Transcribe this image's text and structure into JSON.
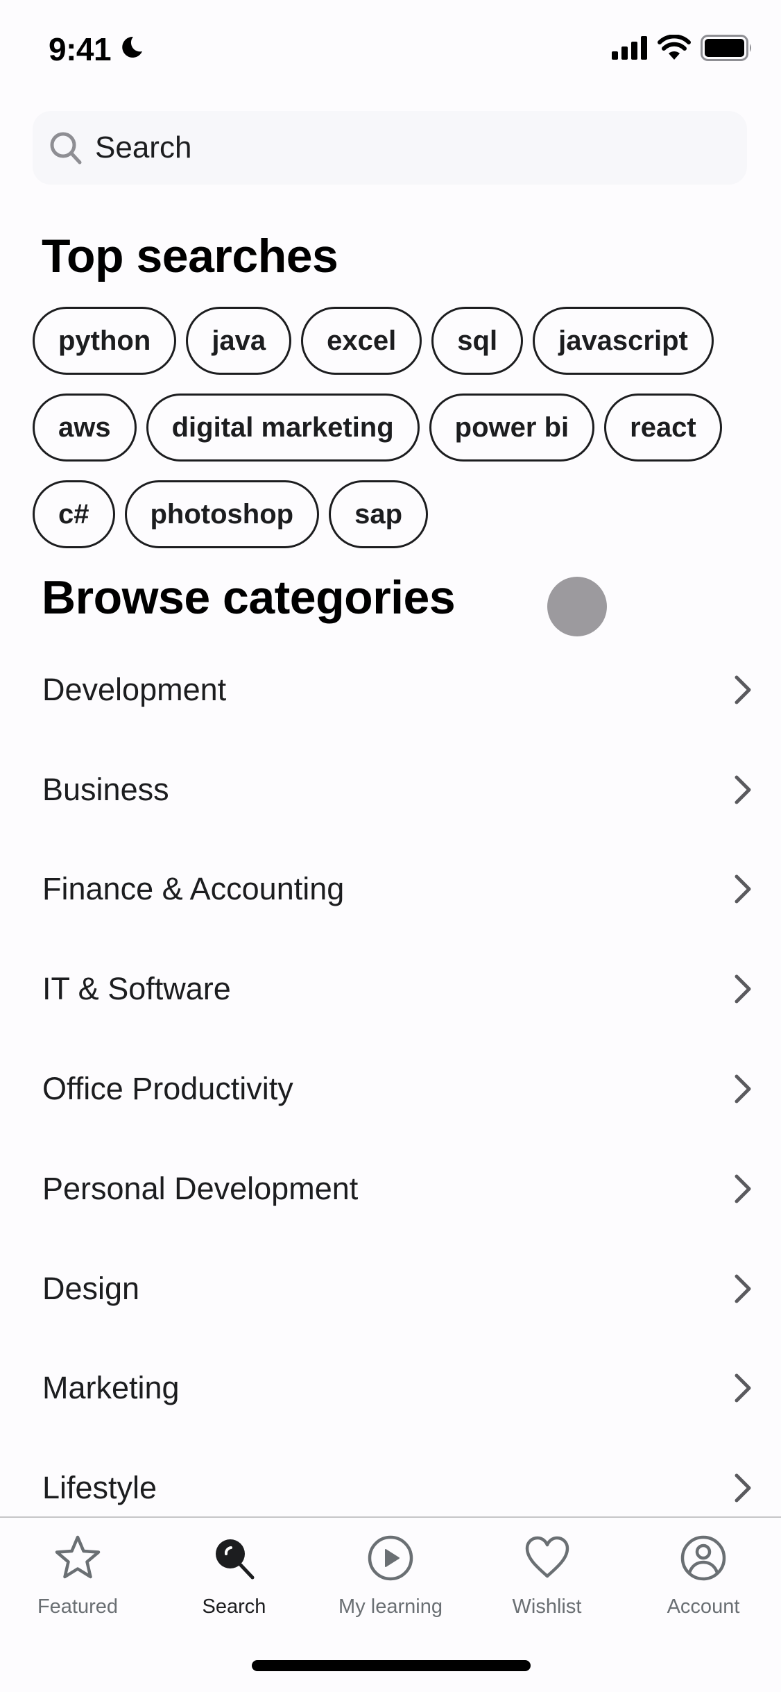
{
  "status_bar": {
    "time": "9:41",
    "icons": [
      "moon-icon",
      "signal-icon",
      "wifi-icon",
      "battery-icon"
    ]
  },
  "search": {
    "placeholder": "Search",
    "icon": "search-icon"
  },
  "top_searches": {
    "title": "Top searches",
    "chips": [
      "python",
      "java",
      "excel",
      "sql",
      "javascript",
      "aws",
      "digital marketing",
      "power bi",
      "react",
      "c#",
      "photoshop",
      "sap"
    ]
  },
  "browse": {
    "title": "Browse categories",
    "categories": [
      {
        "label": "Development"
      },
      {
        "label": "Business"
      },
      {
        "label": "Finance & Accounting"
      },
      {
        "label": "IT & Software"
      },
      {
        "label": "Office Productivity"
      },
      {
        "label": "Personal Development"
      },
      {
        "label": "Design"
      },
      {
        "label": "Marketing"
      },
      {
        "label": "Lifestyle"
      }
    ]
  },
  "tab_bar": {
    "active": "Search",
    "tabs": [
      {
        "label": "Featured",
        "icon": "star-icon"
      },
      {
        "label": "Search",
        "icon": "search-icon"
      },
      {
        "label": "My learning",
        "icon": "play-circle-icon"
      },
      {
        "label": "Wishlist",
        "icon": "heart-icon"
      },
      {
        "label": "Account",
        "icon": "account-icon"
      }
    ]
  },
  "colors": {
    "text": "#1c1d1f",
    "muted": "#6a6f73",
    "search_bg": "#f7f7fa",
    "chevron": "#5a5a5e"
  }
}
